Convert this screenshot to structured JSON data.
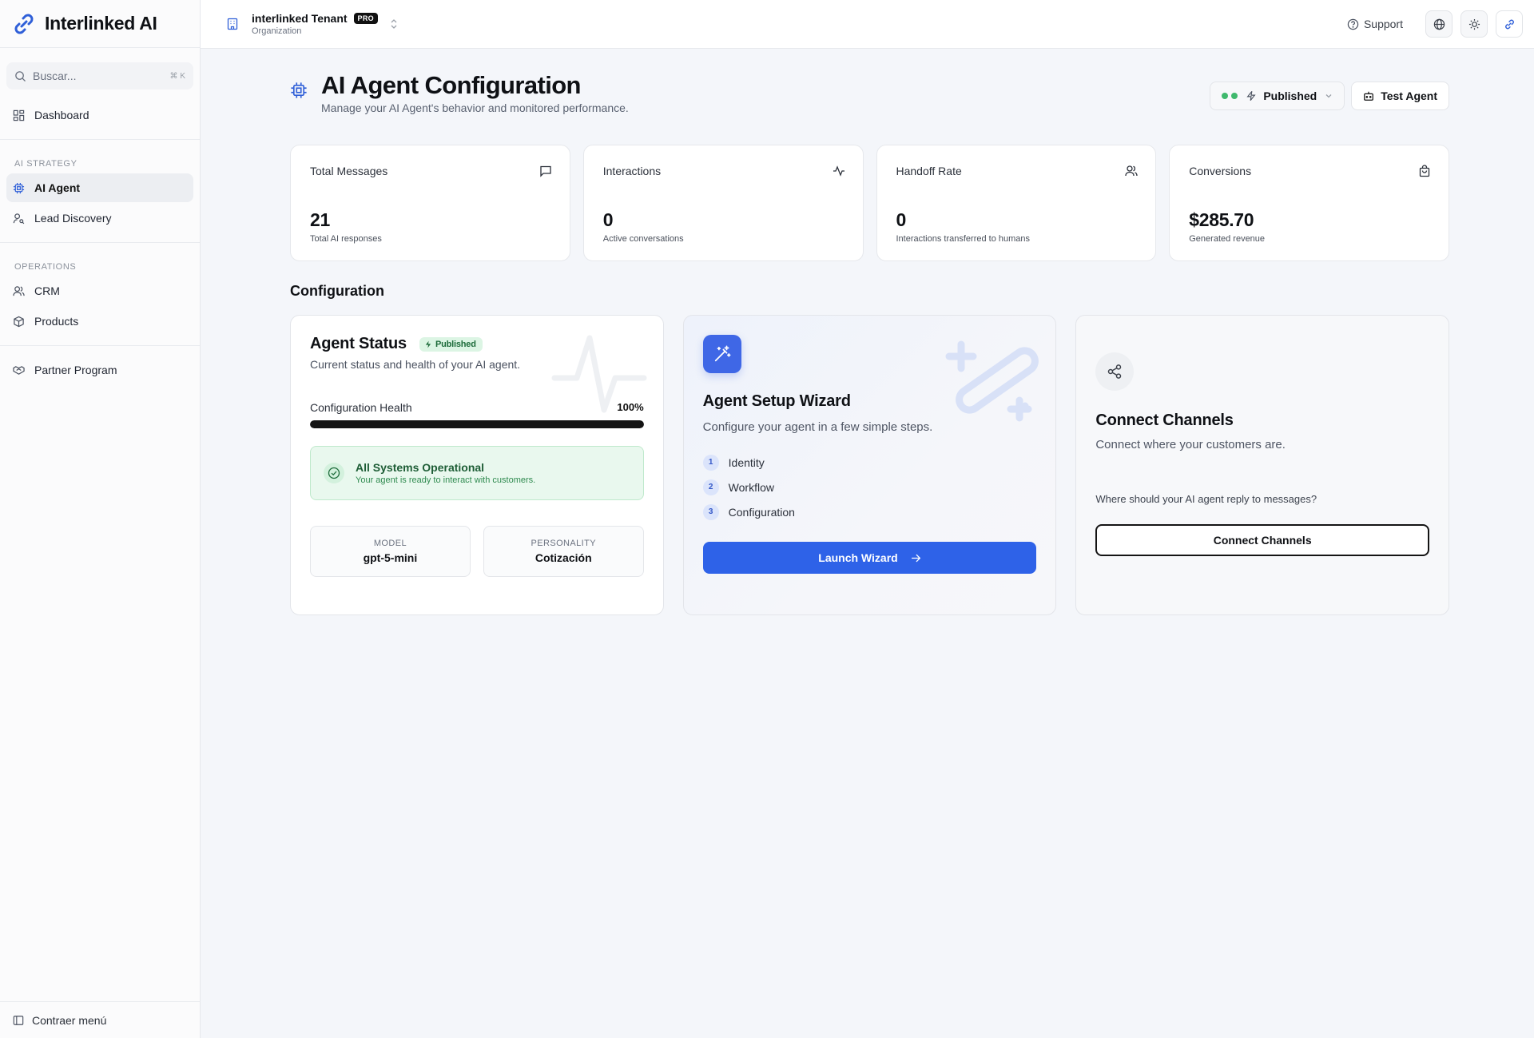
{
  "app": {
    "name": "Interlinked AI"
  },
  "sidebar": {
    "search_placeholder": "Buscar...",
    "search_shortcut": "⌘ K",
    "dashboard": "Dashboard",
    "section_ai": "AI STRATEGY",
    "ai_agent": "AI Agent",
    "lead_discovery": "Lead Discovery",
    "section_ops": "OPERATIONS",
    "crm": "CRM",
    "products": "Products",
    "partner": "Partner Program",
    "collapse": "Contraer menú"
  },
  "topbar": {
    "tenant": "interlinked Tenant",
    "badge": "PRO",
    "tenant_sub": "Organization",
    "support": "Support"
  },
  "page": {
    "title": "AI Agent Configuration",
    "subtitle": "Manage your AI Agent's behavior and monitored performance.",
    "status_btn": "Published",
    "test_btn": "Test Agent"
  },
  "stats": [
    {
      "title": "Total Messages",
      "value": "21",
      "sub": "Total AI responses",
      "icon": "message-icon"
    },
    {
      "title": "Interactions",
      "value": "0",
      "sub": "Active conversations",
      "icon": "activity-icon"
    },
    {
      "title": "Handoff Rate",
      "value": "0",
      "sub": "Interactions transferred to humans",
      "icon": "users-icon"
    },
    {
      "title": "Conversions",
      "value": "$285.70",
      "sub": "Generated revenue",
      "icon": "bag-icon"
    }
  ],
  "config": {
    "section_title": "Configuration",
    "status": {
      "title": "Agent Status",
      "badge": "Published",
      "sub": "Current status and health of your AI agent.",
      "health_label": "Configuration Health",
      "health_pct": "100%",
      "health_value": 1.0,
      "ops_title": "All Systems Operational",
      "ops_sub": "Your agent is ready to interact with customers.",
      "model_label": "MODEL",
      "model_value": "gpt-5-mini",
      "personality_label": "PERSONALITY",
      "personality_value": "Cotización"
    },
    "wizard": {
      "title": "Agent Setup Wizard",
      "sub": "Configure your agent in a few simple steps.",
      "steps": [
        {
          "num": "1",
          "label": "Identity"
        },
        {
          "num": "2",
          "label": "Workflow"
        },
        {
          "num": "3",
          "label": "Configuration"
        }
      ],
      "button": "Launch Wizard"
    },
    "channels": {
      "title": "Connect Channels",
      "sub": "Connect where your customers are.",
      "question": "Where should your AI agent reply to messages?",
      "button": "Connect Channels"
    }
  },
  "colors": {
    "accent": "#2e62e8",
    "success": "#3fb96d",
    "brand": "#2f5fd8"
  }
}
